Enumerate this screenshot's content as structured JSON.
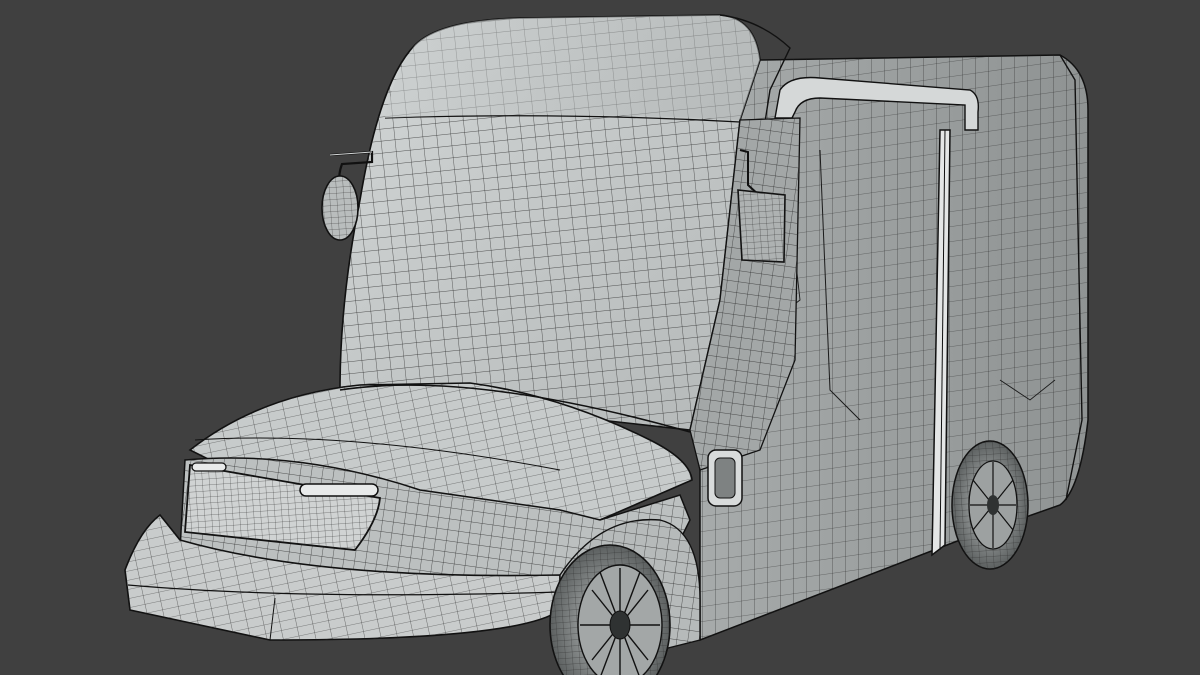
{
  "scene": {
    "background_color": "#404040",
    "surface_color": "#c4c8c8",
    "surface_shadow_color": "#8e9292",
    "wire_color": "#2b2b2b",
    "hard_edge_color": "#111111",
    "subject": "delivery-van-wireframe-model"
  }
}
